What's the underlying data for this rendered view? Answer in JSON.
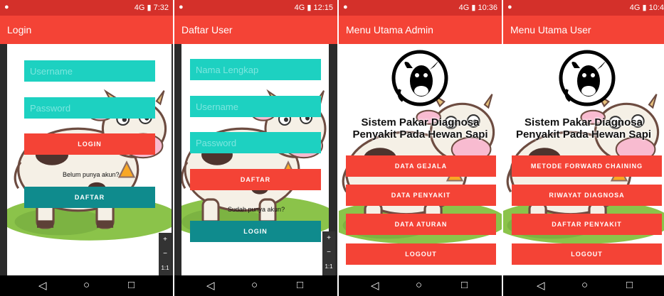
{
  "status_signal": "4G",
  "screens": [
    {
      "time": "7:32",
      "app_title": "Login",
      "username_placeholder": "Username",
      "password_placeholder": "Password",
      "login_button": "LOGIN",
      "no_account_text": "Belum punya akun?",
      "register_button": "DAFTAR"
    },
    {
      "time": "12:15",
      "app_title": "Daftar User",
      "fullname_placeholder": "Nama Lengkap",
      "username_placeholder": "Username",
      "password_placeholder": "Password",
      "register_button": "DAFTAR",
      "have_account_text": "Sudah punya akun?",
      "login_button": "LOGIN"
    },
    {
      "time": "10:36",
      "app_title": "Menu Utama Admin",
      "heading_line1": "Sistem Pakar Diagnosa",
      "heading_line2": "Penyakit Pada Hewan Sapi",
      "menu": [
        "DATA GEJALA",
        "DATA PENYAKIT",
        "DATA ATURAN",
        "LOGOUT"
      ]
    },
    {
      "time": "10:4",
      "app_title": "Menu Utama User",
      "heading_line1": "Sistem Pakar Diagnosa",
      "heading_line2": "Penyakit Pada Hewan Sapi",
      "menu": [
        "METODE FORWARD CHAINING",
        "RIWAYAT DIAGNOSA",
        "DAFTAR PENYAKIT",
        "LOGOUT"
      ]
    }
  ],
  "zoom_controls": {
    "plus": "+",
    "minus": "−",
    "ratio": "1:1"
  },
  "nav_icons": [
    "back-icon",
    "home-icon",
    "recents-icon"
  ],
  "colors": {
    "primary": "#f44336",
    "status": "#d4302a",
    "field": "#1dd1c1",
    "teal_button": "#0f8b8d"
  }
}
